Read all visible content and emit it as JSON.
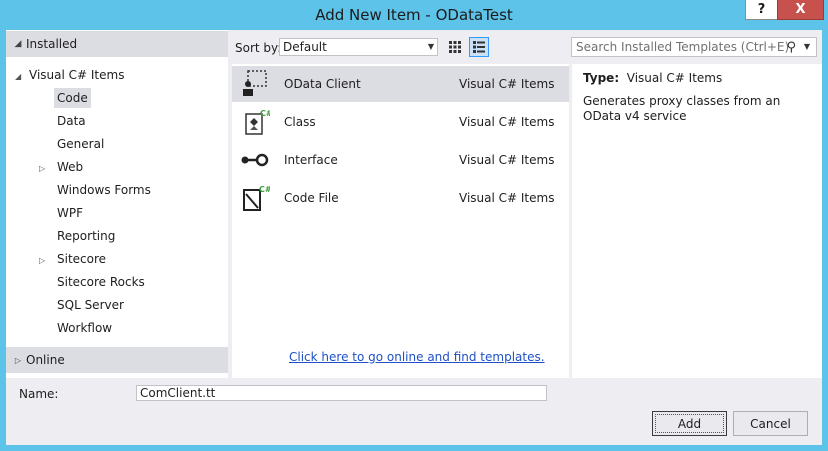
{
  "window": {
    "title": "Add New Item - ODataTest",
    "help_label": "?",
    "close_label": "X"
  },
  "sidebar": {
    "installed_label": "Installed",
    "online_label": "Online",
    "root_label": "Visual C# Items",
    "items": [
      {
        "label": "Code",
        "selected": true,
        "expandable": false
      },
      {
        "label": "Data",
        "expandable": false
      },
      {
        "label": "General",
        "expandable": false
      },
      {
        "label": "Web",
        "expandable": true
      },
      {
        "label": "Windows Forms",
        "expandable": false
      },
      {
        "label": "WPF",
        "expandable": false
      },
      {
        "label": "Reporting",
        "expandable": false
      },
      {
        "label": "Sitecore",
        "expandable": true
      },
      {
        "label": "Sitecore Rocks",
        "expandable": false
      },
      {
        "label": "SQL Server",
        "expandable": false
      },
      {
        "label": "Workflow",
        "expandable": false
      }
    ]
  },
  "toolbar": {
    "sort_label": "Sort by:",
    "sort_value": "Default",
    "search_placeholder": "Search Installed Templates (Ctrl+E)"
  },
  "templates": [
    {
      "name": "OData Client",
      "type": "Visual C# Items",
      "icon": "odata-client-icon",
      "selected": true
    },
    {
      "name": "Class",
      "type": "Visual C# Items",
      "icon": "class-icon"
    },
    {
      "name": "Interface",
      "type": "Visual C# Items",
      "icon": "interface-icon"
    },
    {
      "name": "Code File",
      "type": "Visual C# Items",
      "icon": "code-file-icon"
    }
  ],
  "online_link": "Click here to go online and find templates.",
  "details": {
    "type_label": "Type:",
    "type_value": "Visual C# Items",
    "description": "Generates proxy classes from an OData v4 service"
  },
  "footer": {
    "name_label": "Name:",
    "name_value": "ComClient.tt",
    "add_label": "Add",
    "cancel_label": "Cancel"
  }
}
